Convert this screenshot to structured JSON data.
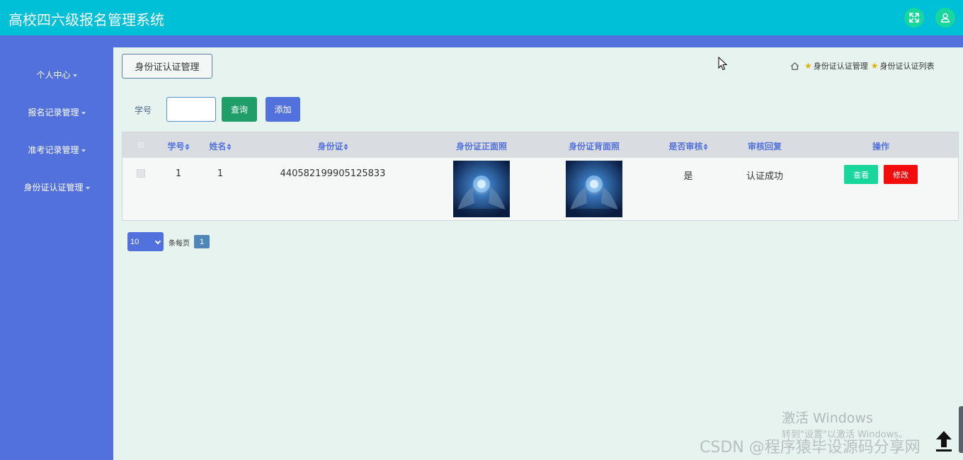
{
  "app": {
    "title": "高校四六级报名管理系统"
  },
  "header": {
    "icons": [
      "expand-icon",
      "user-icon"
    ]
  },
  "sidebar": {
    "items": [
      {
        "label": "个人中心"
      },
      {
        "label": "报名记录管理"
      },
      {
        "label": "准考记录管理"
      },
      {
        "label": "身份证认证管理"
      }
    ]
  },
  "tab": {
    "label": "身份证认证管理"
  },
  "breadcrumb": {
    "items": [
      "身份证认证管理",
      "身份证认证列表"
    ]
  },
  "search": {
    "label": "学号",
    "value": "",
    "placeholder": "",
    "query_label": "查询",
    "add_label": "添加"
  },
  "table": {
    "headers": [
      "学号",
      "姓名",
      "身份证",
      "身份证正面照",
      "身份证背面照",
      "是否审核",
      "审核回复",
      "操作"
    ],
    "rows": [
      {
        "student_id": "1",
        "name": "1",
        "id_card": "440582199905125833",
        "audited": "是",
        "reply": "认证成功",
        "view_label": "查看",
        "edit_label": "修改"
      }
    ]
  },
  "pagination": {
    "page_size": "10",
    "per_page_label": "条每页",
    "current_page": "1"
  },
  "watermark": {
    "line1": "激活 Windows",
    "line2": "转到\"设置\"以激活 Windows。",
    "credit": "CSDN @程序猿毕设源码分享网"
  },
  "colors": {
    "topbar": "#00c0d8",
    "sidebar": "#5271dc",
    "icon_circle": "#19d69d",
    "query_button": "#1f9e6a",
    "edit_button": "#f20c0c",
    "background": "#e6f3ee"
  }
}
